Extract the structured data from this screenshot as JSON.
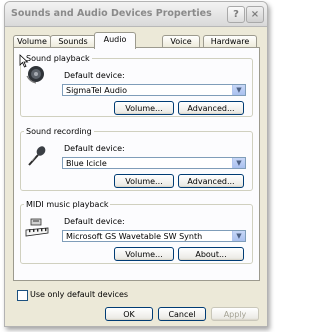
{
  "window": {
    "title": "Sounds and Audio Devices Properties"
  },
  "caption_buttons": {
    "help": "?",
    "close": "×"
  },
  "tabs": [
    {
      "label": "Volume"
    },
    {
      "label": "Sounds"
    },
    {
      "label": "Audio"
    },
    {
      "label": "Voice"
    },
    {
      "label": "Hardware"
    }
  ],
  "playback": {
    "legend": "Sound playback",
    "default_label": "Default device:",
    "device": "SigmaTel Audio",
    "volume_btn": "Volume...",
    "advanced_btn": "Advanced..."
  },
  "recording": {
    "legend": "Sound recording",
    "default_label": "Default device:",
    "device": "Blue Icicle",
    "volume_btn": "Volume...",
    "advanced_btn": "Advanced..."
  },
  "midi": {
    "legend": "MIDI music playback",
    "default_label": "Default device:",
    "device": "Microsoft GS Wavetable SW Synth",
    "volume_btn": "Volume...",
    "about_btn": "About..."
  },
  "use_default": {
    "label": "Use only default devices",
    "checked": false
  },
  "footer": {
    "ok": "OK",
    "cancel": "Cancel",
    "apply": "Apply"
  },
  "colors": {
    "accent_border": "#003c74",
    "combo_border": "#7f9db9",
    "dialog_bg": "#ece9d8"
  },
  "icons": [
    "speaker-icon",
    "microphone-icon",
    "midi-keyboard-icon",
    "cursor-icon"
  ]
}
